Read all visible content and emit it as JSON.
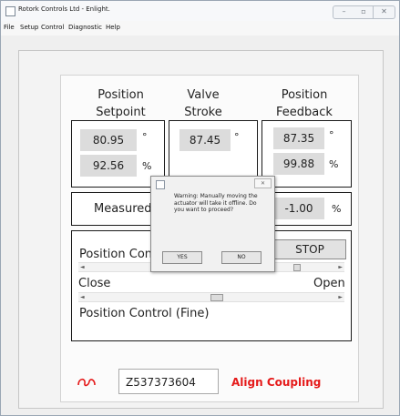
{
  "window": {
    "title": "Rotork Controls Ltd - Enlight."
  },
  "menu": [
    "File",
    "Setup",
    "Control",
    "Diagnostic",
    "Help"
  ],
  "columns": {
    "position_setpoint": {
      "line1": "Position",
      "line2": "Setpoint",
      "value_deg": "80.95",
      "unit_deg": "°",
      "value_pct": "92.56",
      "unit_pct": "%"
    },
    "valve_stroke": {
      "line1": "Valve",
      "line2": "Stroke",
      "value_deg": "87.45",
      "unit_deg": "°"
    },
    "position_feedback": {
      "line1": "Position",
      "line2": "Feedback",
      "value_deg": "87.35",
      "unit_deg": "°",
      "value_pct": "99.88",
      "unit_pct": "%"
    }
  },
  "measured": {
    "label": "Measured",
    "value": "-1.00",
    "unit": "%"
  },
  "position_control": {
    "label": "Position Con",
    "stop_label": "STOP",
    "close_label": "Close",
    "open_label": "Open",
    "fine_label": "Position Control (Fine)"
  },
  "footer": {
    "serial": "Z537373604",
    "status": "Align Coupling"
  },
  "dialog": {
    "message": "Warning: Manually moving the actuator will take it offline. Do you want to proceed?",
    "yes_label": "YES",
    "no_label": "NO"
  }
}
